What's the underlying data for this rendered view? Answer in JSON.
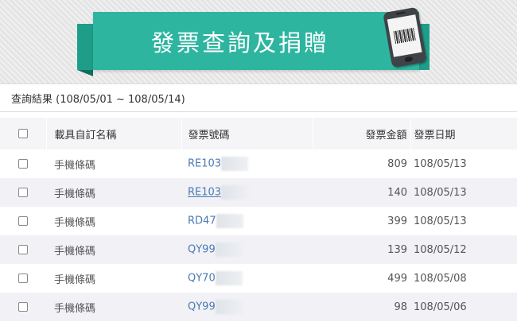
{
  "banner": {
    "title": "發票查詢及捐贈",
    "icon": "phone-barcode-icon"
  },
  "colors": {
    "banner": "#2db5a0",
    "link": "#4a7ab3"
  },
  "result": {
    "heading": "查詢結果 (108/05/01 ~ 108/05/14)",
    "columns": {
      "carrier": "載具自訂名稱",
      "invoice": "發票號碼",
      "amount": "發票金額",
      "date": "發票日期"
    },
    "rows": [
      {
        "carrier": "手機條碼",
        "invoice": "RE103",
        "amount": "809",
        "date": "108/05/13"
      },
      {
        "carrier": "手機條碼",
        "invoice": "RE103",
        "amount": "140",
        "date": "108/05/13"
      },
      {
        "carrier": "手機條碼",
        "invoice": "RD47",
        "amount": "399",
        "date": "108/05/13"
      },
      {
        "carrier": "手機條碼",
        "invoice": "QY99",
        "amount": "139",
        "date": "108/05/12"
      },
      {
        "carrier": "手機條碼",
        "invoice": "QY70",
        "amount": "499",
        "date": "108/05/08"
      },
      {
        "carrier": "手機條碼",
        "invoice": "QY99",
        "amount": "98",
        "date": "108/05/06"
      }
    ]
  }
}
